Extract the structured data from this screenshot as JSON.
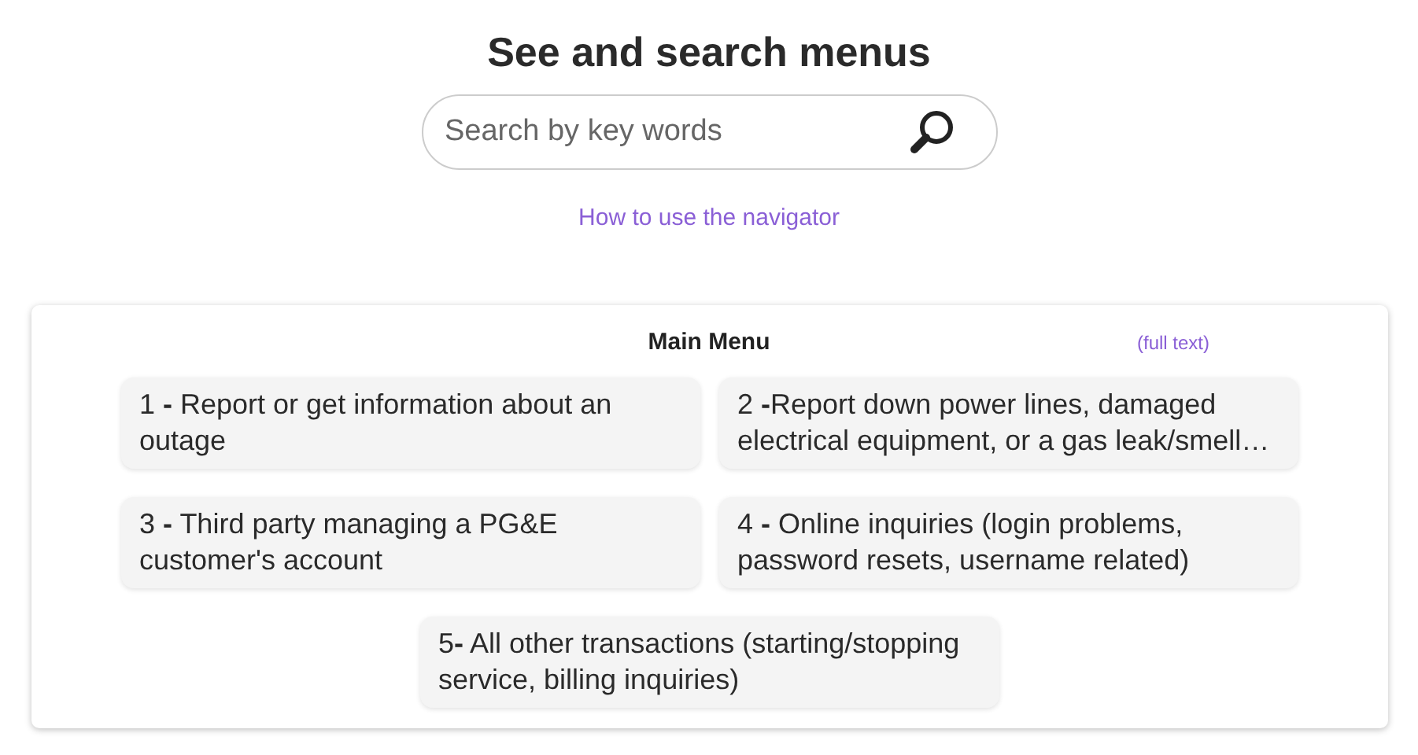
{
  "title": "See and search menus",
  "search": {
    "placeholder": "Search by key words"
  },
  "help_link": "How to use the navigator",
  "menu": {
    "title": "Main Menu",
    "full_text_link": "(full text)",
    "items": [
      {
        "label": "1 **-** Report or get information about an outage"
      },
      {
        "label": "2 **-**Report down power lines, damaged electrical equipment, or a gas leak/smell…"
      },
      {
        "label": "3 **-** Third party managing a PG&E customer's account"
      },
      {
        "label": "4 **-** Online inquiries (login problems, password resets, username related)"
      },
      {
        "label": "5**-** All other transactions (starting/stopping service, billing inquiries)"
      }
    ]
  }
}
